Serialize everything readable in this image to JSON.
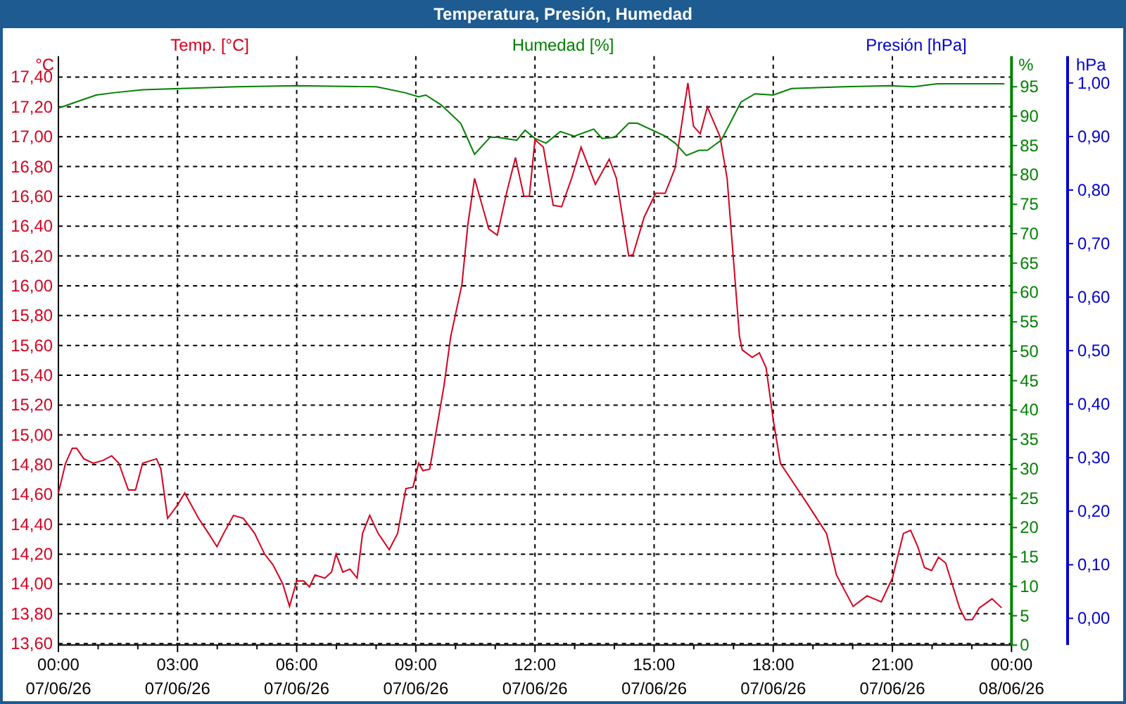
{
  "window": {
    "title": "Temperatura, Presión, Humedad"
  },
  "chart": {
    "tick_dates": [
      "07/06/26",
      "07/06/26",
      "07/06/26",
      "07/06/26",
      "07/06/26",
      "07/06/26",
      "07/06/26",
      "07/06/26",
      "08/06/26"
    ],
    "chart_data": {
      "type": "line",
      "grid": true,
      "xlim": [
        0,
        24
      ],
      "xticks": [
        {
          "value": 0,
          "label": "00:00"
        },
        {
          "value": 3,
          "label": "03:00"
        },
        {
          "value": 6,
          "label": "06:00"
        },
        {
          "value": 9,
          "label": "09:00"
        },
        {
          "value": 12,
          "label": "12:00"
        },
        {
          "value": 15,
          "label": "15:00"
        },
        {
          "value": 18,
          "label": "18:00"
        },
        {
          "value": 21,
          "label": "21:00"
        },
        {
          "value": 24,
          "label": "00:00"
        }
      ],
      "ylabel": "°C",
      "ylim": [
        13.59,
        17.54
      ],
      "yticks": [
        {
          "value": 13.6,
          "label": "13,60"
        },
        {
          "value": 13.8,
          "label": "13,80"
        },
        {
          "value": 14.0,
          "label": "14,00"
        },
        {
          "value": 14.2,
          "label": "14,20"
        },
        {
          "value": 14.4,
          "label": "14,40"
        },
        {
          "value": 14.6,
          "label": "14,60"
        },
        {
          "value": 14.8,
          "label": "14,80"
        },
        {
          "value": 15.0,
          "label": "15,00"
        },
        {
          "value": 15.2,
          "label": "15,20"
        },
        {
          "value": 15.4,
          "label": "15,40"
        },
        {
          "value": 15.6,
          "label": "15,60"
        },
        {
          "value": 15.8,
          "label": "15,80"
        },
        {
          "value": 16.0,
          "label": "16,00"
        },
        {
          "value": 16.2,
          "label": "16,20"
        },
        {
          "value": 16.4,
          "label": "16,40"
        },
        {
          "value": 16.6,
          "label": "16,60"
        },
        {
          "value": 16.8,
          "label": "16,80"
        },
        {
          "value": 17.0,
          "label": "17,00"
        },
        {
          "value": 17.2,
          "label": "17,20"
        },
        {
          "value": 17.4,
          "label": "17,40"
        }
      ],
      "y2label": "%",
      "y2lim": [
        0,
        100.2
      ],
      "y2ticks": [
        {
          "value": 0,
          "label": "0"
        },
        {
          "value": 5,
          "label": "5"
        },
        {
          "value": 10,
          "label": "10"
        },
        {
          "value": 15,
          "label": "15"
        },
        {
          "value": 20,
          "label": "20"
        },
        {
          "value": 25,
          "label": "25"
        },
        {
          "value": 30,
          "label": "30"
        },
        {
          "value": 35,
          "label": "35"
        },
        {
          "value": 40,
          "label": "40"
        },
        {
          "value": 45,
          "label": "45"
        },
        {
          "value": 50,
          "label": "50"
        },
        {
          "value": 55,
          "label": "55"
        },
        {
          "value": 60,
          "label": "60"
        },
        {
          "value": 65,
          "label": "65"
        },
        {
          "value": 70,
          "label": "70"
        },
        {
          "value": 75,
          "label": "75"
        },
        {
          "value": 80,
          "label": "80"
        },
        {
          "value": 85,
          "label": "85"
        },
        {
          "value": 90,
          "label": "90"
        },
        {
          "value": 95,
          "label": "95"
        }
      ],
      "y3label": "hPa",
      "y3lim": [
        -0.05,
        1.05
      ],
      "y3ticks": [
        {
          "value": 0,
          "label": "0,00"
        },
        {
          "value": 0.1,
          "label": "0,10"
        },
        {
          "value": 0.2,
          "label": "0,20"
        },
        {
          "value": 0.3,
          "label": "0,30"
        },
        {
          "value": 0.4,
          "label": "0,40"
        },
        {
          "value": 0.5,
          "label": "0,50"
        },
        {
          "value": 0.6,
          "label": "0,60"
        },
        {
          "value": 0.7,
          "label": "0,70"
        },
        {
          "value": 0.8,
          "label": "0,80"
        },
        {
          "value": 0.9,
          "label": "0,90"
        },
        {
          "value": 1.0,
          "label": "1,00"
        }
      ],
      "series": [
        {
          "name": "Temp. [°C]",
          "color": "#d4001e",
          "x": [
            0,
            0.18,
            0.35,
            0.46,
            0.64,
            0.88,
            1.13,
            1.34,
            1.52,
            1.76,
            1.94,
            2.12,
            2.47,
            2.58,
            2.75,
            3.0,
            3.18,
            3.53,
            3.78,
            3.99,
            4.16,
            4.41,
            4.66,
            4.94,
            5.19,
            5.4,
            5.65,
            5.82,
            6.0,
            6.18,
            6.32,
            6.46,
            6.71,
            6.88,
            6.99,
            7.16,
            7.34,
            7.52,
            7.66,
            7.84,
            8.05,
            8.33,
            8.54,
            8.75,
            8.93,
            9.07,
            9.18,
            9.35,
            9.53,
            9.71,
            9.88,
            10.16,
            10.31,
            10.48,
            10.84,
            11.05,
            11.29,
            11.51,
            11.72,
            11.86,
            12.0,
            12.21,
            12.46,
            12.67,
            12.92,
            13.16,
            13.52,
            13.87,
            14.05,
            14.36,
            14.47,
            14.75,
            15.04,
            15.28,
            15.53,
            15.85,
            15.99,
            16.16,
            16.34,
            16.66,
            16.84,
            17.15,
            17.22,
            17.47,
            17.65,
            17.82,
            18.0,
            18.18,
            18.53,
            18.88,
            19.34,
            19.59,
            20.01,
            20.36,
            20.72,
            21.0,
            21.28,
            21.46,
            21.64,
            21.81,
            21.99,
            22.16,
            22.34,
            22.69,
            22.84,
            23.01,
            23.19,
            23.51,
            23.75
          ],
          "values": [
            14.61,
            14.81,
            14.91,
            14.91,
            14.84,
            14.81,
            14.83,
            14.86,
            14.81,
            14.63,
            14.63,
            14.81,
            14.84,
            14.77,
            14.44,
            14.53,
            14.61,
            14.44,
            14.34,
            14.25,
            14.34,
            14.46,
            14.44,
            14.34,
            14.2,
            14.13,
            14.0,
            13.85,
            14.02,
            14.02,
            13.98,
            14.06,
            14.04,
            14.08,
            14.2,
            14.08,
            14.1,
            14.04,
            14.34,
            14.46,
            14.34,
            14.23,
            14.34,
            14.64,
            14.65,
            14.81,
            14.76,
            14.77,
            15.05,
            15.33,
            15.66,
            16.01,
            16.41,
            16.72,
            16.38,
            16.34,
            16.63,
            16.86,
            16.6,
            16.6,
            16.98,
            16.93,
            16.54,
            16.53,
            16.72,
            16.93,
            16.68,
            16.85,
            16.72,
            16.2,
            16.21,
            16.46,
            16.62,
            16.62,
            16.79,
            17.36,
            17.07,
            17.02,
            17.2,
            17.0,
            16.72,
            15.66,
            15.57,
            15.52,
            15.55,
            15.45,
            15.1,
            14.81,
            14.67,
            14.53,
            14.34,
            14.06,
            13.85,
            13.92,
            13.88,
            14.04,
            14.34,
            14.36,
            14.25,
            14.11,
            14.09,
            14.18,
            14.14,
            13.84,
            13.76,
            13.76,
            13.84,
            13.9,
            13.84
          ]
        },
        {
          "name": "Humedad [%]",
          "color": "#008000",
          "axis": "y2",
          "x": [
            0,
            0.11,
            0.95,
            1.41,
            2.12,
            3.07,
            4.48,
            6.0,
            8.01,
            8.72,
            9.07,
            9.25,
            9.64,
            10.13,
            10.48,
            10.87,
            11.05,
            11.54,
            11.75,
            12.0,
            12.28,
            12.64,
            12.99,
            13.48,
            13.69,
            14.01,
            14.36,
            14.58,
            15.28,
            15.53,
            15.81,
            16.13,
            16.34,
            16.69,
            17.19,
            17.54,
            18.0,
            18.46,
            19.76,
            20.93,
            21.53,
            22.13,
            23.82
          ],
          "values": [
            91.4,
            91.6,
            93.6,
            94.0,
            94.5,
            94.7,
            95.0,
            95.2,
            95.0,
            94.0,
            93.3,
            93.6,
            91.9,
            88.8,
            83.5,
            86.4,
            86.4,
            85.9,
            87.6,
            86.2,
            85.4,
            87.4,
            86.6,
            87.8,
            86.2,
            86.4,
            88.8,
            88.8,
            86.6,
            85.4,
            83.3,
            84.2,
            84.2,
            85.9,
            92.4,
            93.8,
            93.6,
            94.7,
            95.0,
            95.2,
            95.0,
            95.5,
            95.5
          ]
        },
        {
          "name": "Presión [hPa]",
          "color": "#0000cc",
          "axis": "y3",
          "values": [
            null
          ]
        }
      ]
    }
  }
}
